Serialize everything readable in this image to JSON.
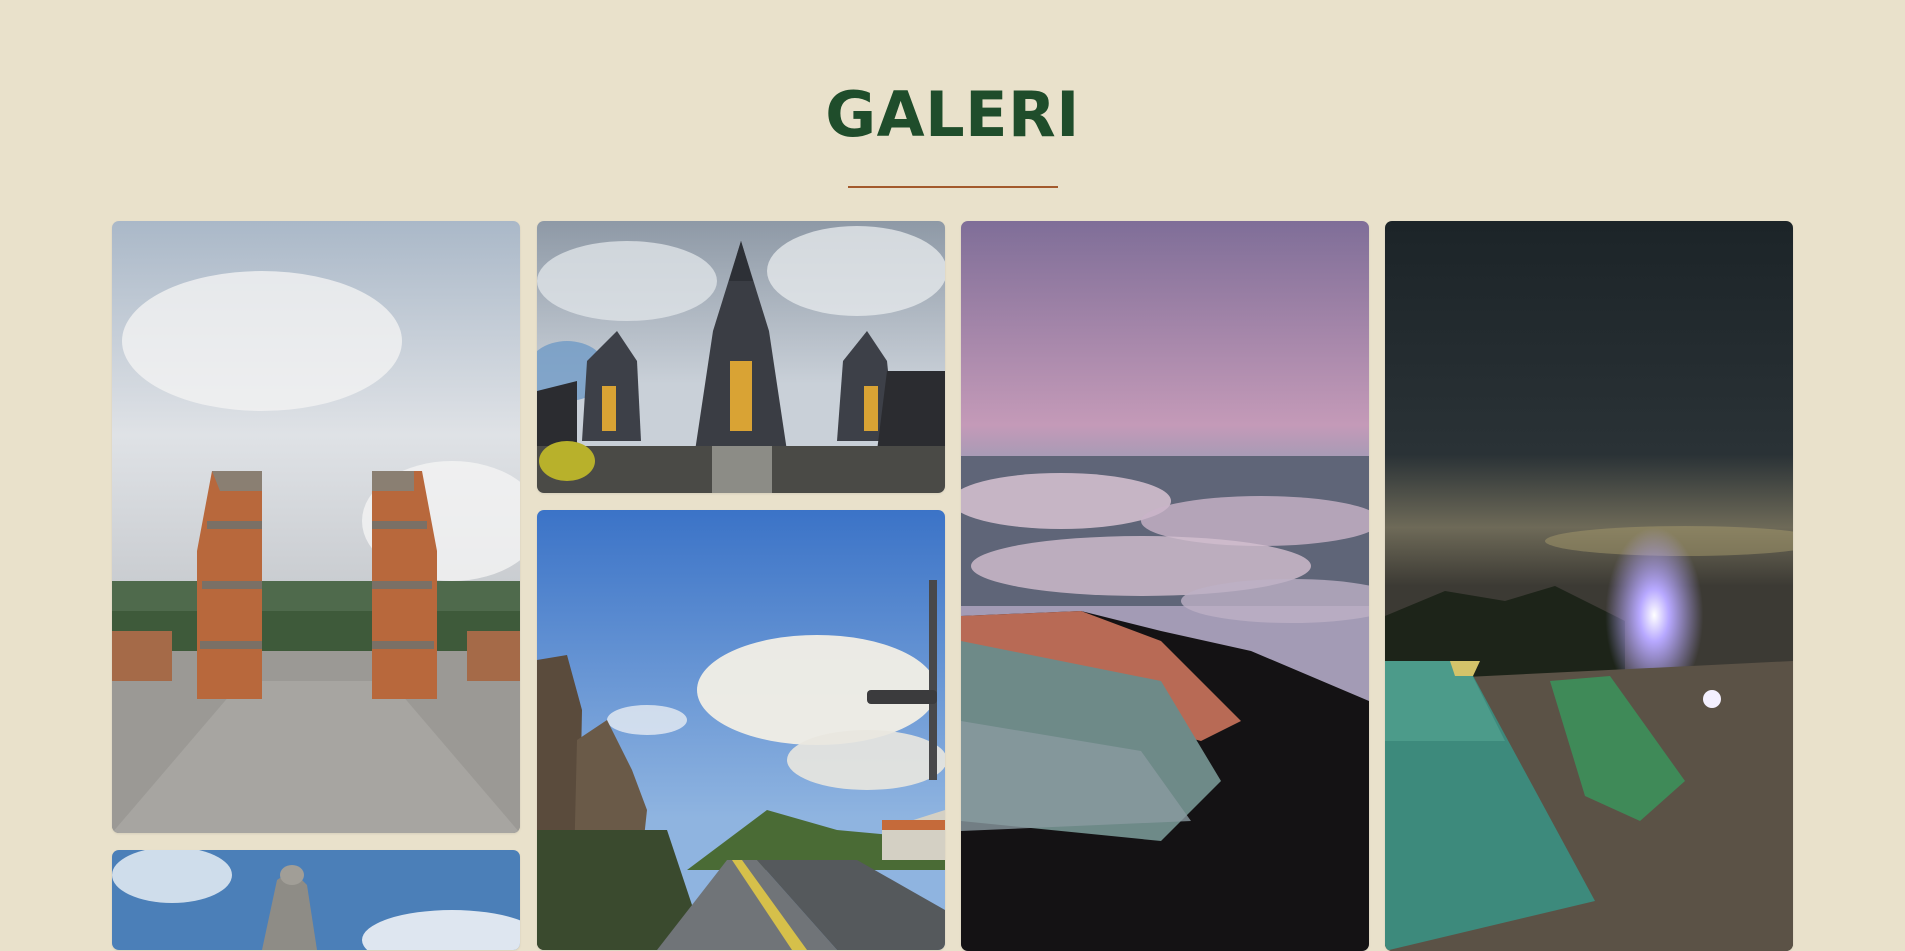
{
  "gallery": {
    "title": "GALERI",
    "photos": [
      {
        "subject": "bali-split-gate-temple"
      },
      {
        "subject": "bali-hindu-temple-pagoda"
      },
      {
        "subject": "mountain-sunrise-sea-of-clouds"
      },
      {
        "subject": "camping-tents-at-night"
      },
      {
        "subject": "temple-statue-blue-sky"
      },
      {
        "subject": "temple-street-blue-sky"
      }
    ]
  },
  "colors": {
    "background": "#e9e1cb",
    "title": "#1f4d2b",
    "divider": "#a35a2c"
  }
}
